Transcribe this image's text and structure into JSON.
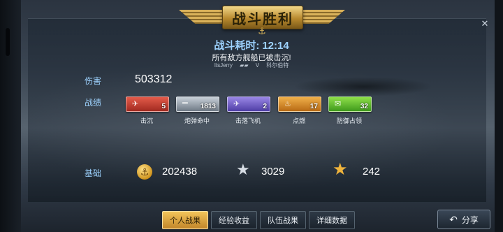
{
  "title": "战斗胜利",
  "battle": {
    "elapsed_label": "战斗耗时:",
    "elapsed_time": "12:14",
    "result_text": "所有敌方舰船已被击沉!",
    "player_left": "ItsJerry",
    "versus": "V",
    "player_right": "科尔伯特"
  },
  "damage": {
    "label": "伤害",
    "value": "503312"
  },
  "achievements": {
    "label": "战绩",
    "medals": [
      {
        "name": "击沉",
        "count": "5",
        "color": "#c7382b",
        "icon": "ship-sink-icon"
      },
      {
        "name": "炮弹命中",
        "count": "1813",
        "color": "#8a96a3",
        "icon": "shell-hit-icon"
      },
      {
        "name": "击落飞机",
        "count": "2",
        "color": "#6a57c9",
        "icon": "plane-down-icon"
      },
      {
        "name": "点燃",
        "count": "17",
        "color": "#d88a22",
        "icon": "fire-icon"
      },
      {
        "name": "防御占领",
        "count": "32",
        "color": "#5cbf2a",
        "icon": "defend-icon"
      }
    ]
  },
  "base": {
    "label": "基础",
    "credits": "202438",
    "experience": "3029",
    "elite_experience": "242"
  },
  "tabs": [
    "个人战果",
    "经验收益",
    "队伍战果",
    "详细数据"
  ],
  "share_label": "分享"
}
